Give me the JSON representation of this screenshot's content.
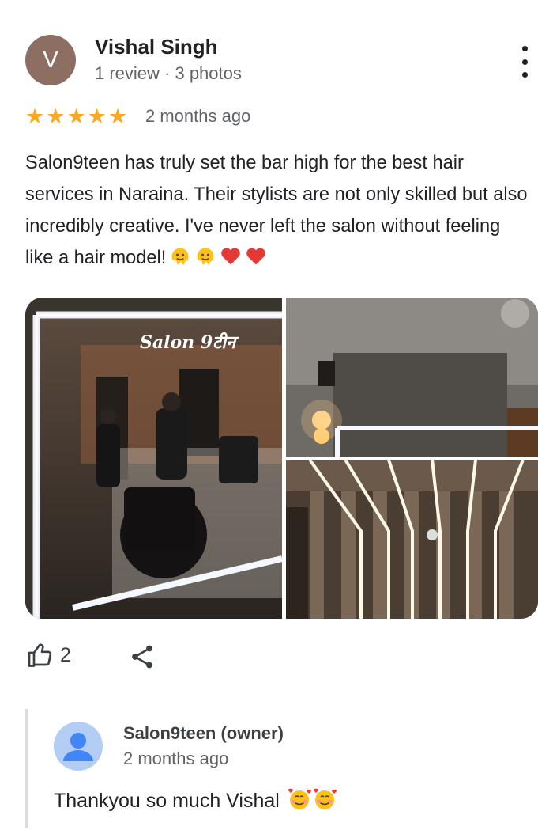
{
  "reviewer": {
    "initial": "V",
    "name": "Vishal Singh",
    "meta": "1 review · 3 photos",
    "avatar_color": "#8d6e63"
  },
  "review": {
    "stars": 5,
    "star_glyph": "★★★★★",
    "date": "2 months ago",
    "text": "Salon9teen has truly set the bar high for the best hair services in Naraina. Their stylists are not only skilled but also incredibly creative. I've never left the salon without feeling like a hair model!",
    "trailing_emojis": [
      "melting-face",
      "melting-face",
      "red-heart",
      "red-heart"
    ]
  },
  "photos": [
    {
      "name": "salon-mirror-photo",
      "sign_text": "Salon 9टीन"
    },
    {
      "name": "salon-ceiling-lights-photo"
    },
    {
      "name": "salon-wood-panel-photo"
    }
  ],
  "actions": {
    "like_count": "2",
    "like_icon": "thumbs-up-icon",
    "share_icon": "share-icon",
    "more_icon": "more-vert-icon"
  },
  "owner_response": {
    "name": "Salon9teen (owner)",
    "date": "2 months ago",
    "text": "Thankyou so much Vishal",
    "emojis": [
      "smiling-face-with-hearts",
      "smiling-face-with-hearts"
    ],
    "avatar_color": "#4285f4"
  },
  "colors": {
    "star": "#f9a825",
    "text": "#202124",
    "secondary": "#5f6368"
  }
}
